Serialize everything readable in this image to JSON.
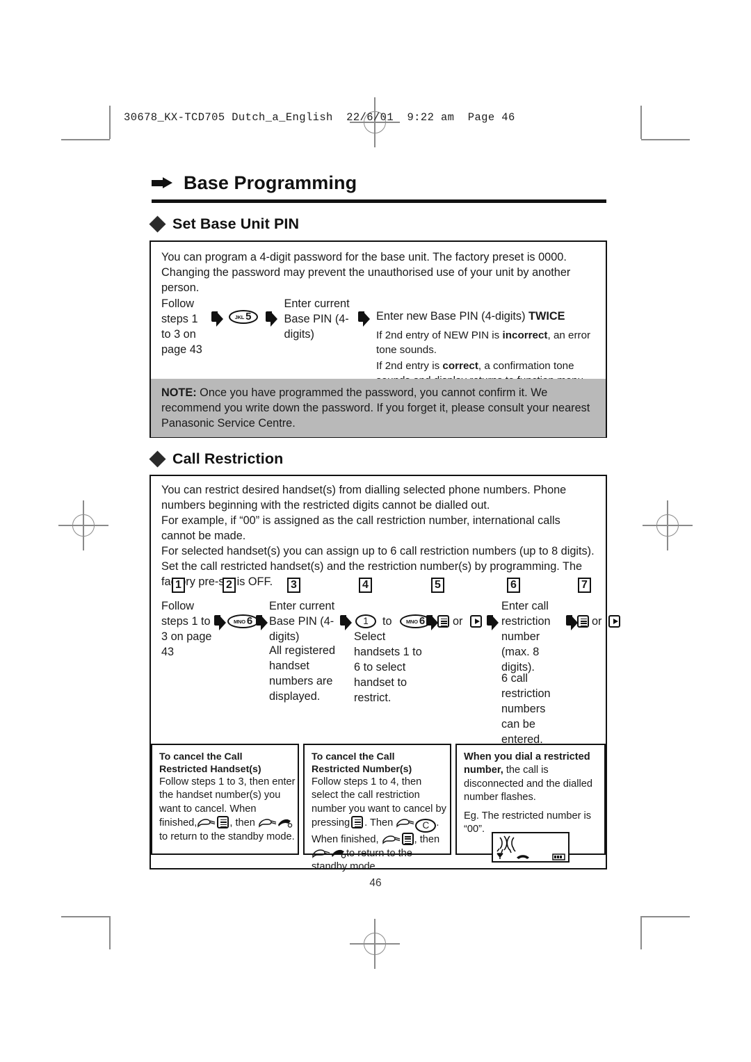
{
  "file_header": "30678_KX-TCD705 Dutch_a_English  22/6/01  9:22 am  Page 46",
  "chapter": {
    "title": "Base Programming"
  },
  "page_number": "46",
  "section_pin": {
    "heading": "Set Base Unit PIN",
    "intro": "You can program a 4-digit password for the base unit. The factory preset is 0000. Changing the password may prevent the unauthorised use of your unit by another person.",
    "flow": {
      "step1": "Follow steps 1 to 3 on page 43",
      "key": {
        "letters": "JKL",
        "digit": "5"
      },
      "step3": "Enter current Base PIN (4-digits)",
      "step4_title_a": "Enter new Base PIN  (4-digits) ",
      "step4_title_b": "TWICE",
      "step4_line1_a": "If 2nd entry of NEW PIN is ",
      "step4_line1_b": "incorrect",
      "step4_line1_c": ", an error tone sounds.",
      "step4_line2_a": "If 2nd entry is ",
      "step4_line2_b": "correct",
      "step4_line2_c": ", a confirmation tone sounds and display returns to function menu."
    },
    "note_label": "NOTE:",
    "note_text": " Once you have programmed the password, you cannot confirm it. We recommend you write down the password. If you forget it, please consult your nearest Panasonic Service Centre."
  },
  "section_restriction": {
    "heading": "Call Restriction",
    "intro_lines": [
      "You can restrict desired handset(s) from dialling selected phone numbers. Phone numbers beginning with the restricted digits cannot be dialled out.",
      "For example, if “00” is assigned as the call restriction number, international calls cannot be made.",
      "For selected handset(s) you can assign up to 6 call restriction numbers (up to 8 digits). Set the call restricted handset(s) and the restriction number(s) by programming. The factory pre-set is OFF."
    ],
    "step_numbers": [
      "1",
      "2",
      "3",
      "4",
      "5",
      "6",
      "7"
    ],
    "steps": {
      "s1": "Follow steps 1 to 3 on page 43",
      "s2_key": {
        "letters": "MNO",
        "digit": "6"
      },
      "s3_top": "Enter current Base PIN (4-digits)",
      "s3_body": "All registered handset numbers are displayed.",
      "s4_from": "1",
      "s4_to_label": "to",
      "s4_key": {
        "letters": "MNO",
        "digit": "6"
      },
      "s4_body": "Select handsets 1 to 6 to select handset to restrict.",
      "s5_or": "or",
      "s6_top": "Enter call restriction number (max. 8 digits).",
      "s6_body": "6 call restriction numbers can be entered.",
      "s7_or": "or"
    },
    "tips": [
      {
        "title": "To cancel the Call Restricted Handset(s)",
        "body_a": "Follow steps 1 to 3, then enter the handset number(s) you want to cancel. When finished,",
        "body_b": ", then",
        "body_c": "to return to the standby mode."
      },
      {
        "title": "To cancel the Call Restricted Number(s)",
        "body_a": "Follow steps 1 to 4, then select the call restriction number you want to cancel by pressing",
        "body_b": ". Then",
        "body_c": "C",
        "body_d": ". When finished,",
        "body_e": ", then",
        "body_f": "to return to the standby mode."
      },
      {
        "title_bold": "When you dial a restricted number,",
        "title_rest": " the call is disconnected and the dialled number flashes.",
        "example": "Eg. The restricted number is “00”."
      }
    ]
  }
}
